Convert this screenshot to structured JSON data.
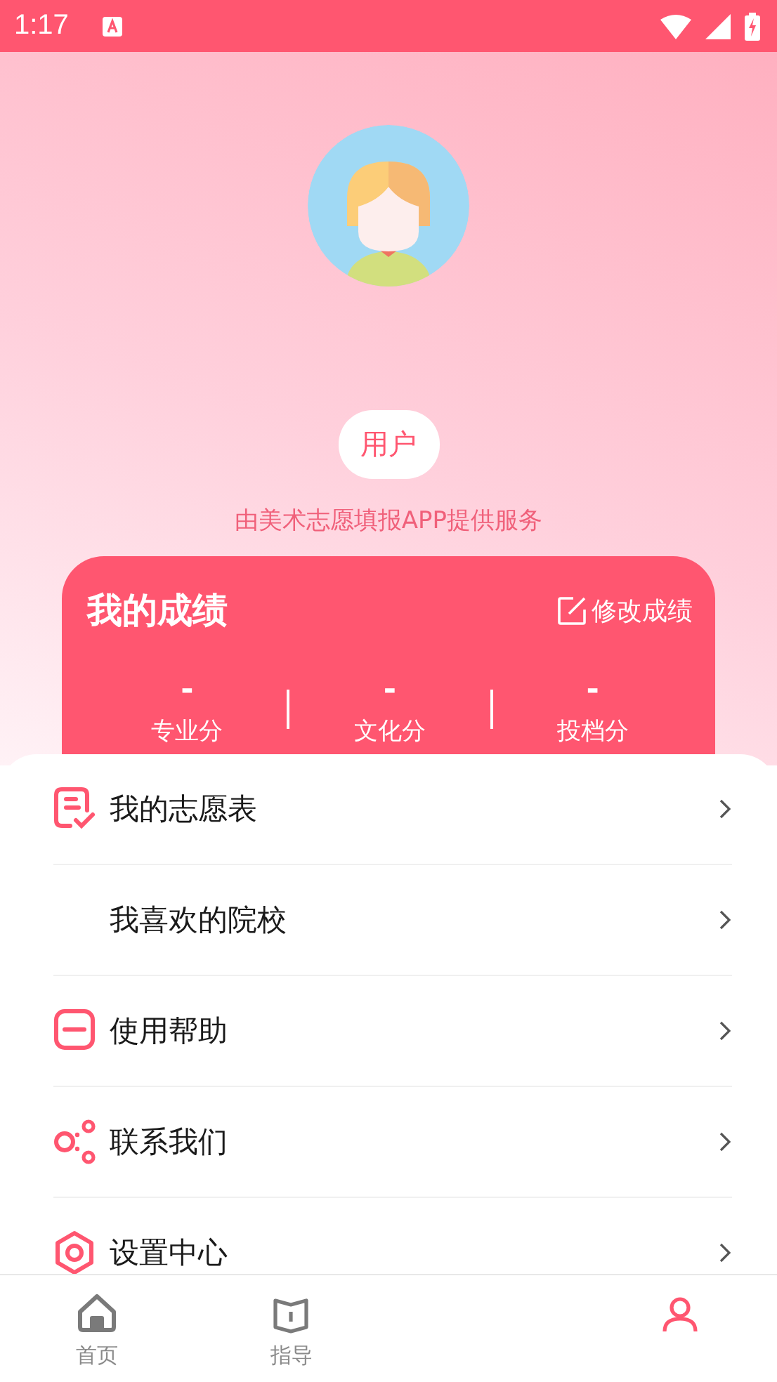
{
  "status_bar": {
    "time": "1:17"
  },
  "profile": {
    "name": "用户",
    "subtitle": "由美术志愿填报APP提供服务"
  },
  "scores_card": {
    "title": "我的成绩",
    "edit_link": "修改成绩",
    "scores": [
      {
        "value": "-",
        "label": "专业分"
      },
      {
        "value": "-",
        "label": "文化分"
      },
      {
        "value": "-",
        "label": "投档分"
      }
    ]
  },
  "menu": [
    {
      "label": "我的志愿表",
      "kind": "form"
    },
    {
      "label": "我喜欢的院校",
      "kind": "none"
    },
    {
      "label": "使用帮助",
      "kind": "help"
    },
    {
      "label": "联系我们",
      "kind": "share"
    },
    {
      "label": "设置中心",
      "kind": "settings"
    }
  ],
  "tab_bar": [
    {
      "label": "首页",
      "kind": "home",
      "selected": false
    },
    {
      "label": "指导",
      "kind": "book",
      "selected": false
    },
    {
      "kind": "blank"
    },
    {
      "kind": "person",
      "selected": true
    }
  ]
}
